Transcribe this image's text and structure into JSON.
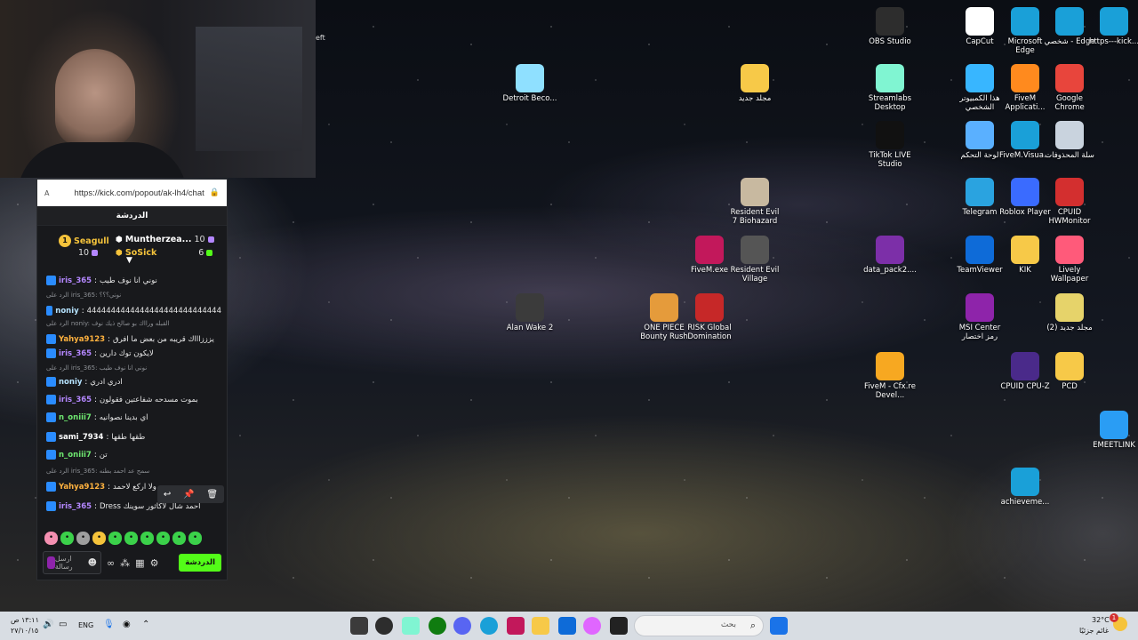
{
  "webcam": {
    "partial_text": "eft"
  },
  "chat": {
    "url": "https://kick.com/popout/ak-lh4/chat",
    "title": "الدردشة",
    "leaders": [
      {
        "rank": "1",
        "name": "Seagull",
        "count": "10",
        "color": "#f5c33b"
      },
      {
        "name": "Muntherzea...",
        "count": "10",
        "color": "#ffffff"
      },
      {
        "name": "SoSick",
        "count": "6",
        "color": "#f5c33b"
      }
    ],
    "messages": [
      {
        "reply": "",
        "user": "iris_365",
        "text": "نوني انا نوف طيب",
        "color": "#b487ff"
      },
      {
        "reply": "الرد على iris_365: نوني؟؟؟",
        "user": "",
        "text": "",
        "color": "#8c8f94"
      },
      {
        "reply": "",
        "user": "noniy",
        "text": "4444444444444444444444444444",
        "color": "#b6e3ff"
      },
      {
        "reply": "الرد على noniy: القبله ورااك بو صالح ذيك نوف",
        "user": "",
        "text": "",
        "color": "#8c8f94"
      },
      {
        "reply": "",
        "user": "Yahya9123",
        "text": "يزززاااك قريبه من بعض ما افرق",
        "color": "#ffb23f"
      },
      {
        "reply": "",
        "user": "iris_365",
        "text": "لايكون توك دارين",
        "color": "#b487ff"
      },
      {
        "reply": "الرد على iris_365: نوني انا نوف طيب",
        "user": "",
        "text": "",
        "color": "#8c8f94"
      },
      {
        "reply": "",
        "user": "noniy",
        "text": "ادري ادري",
        "color": "#b6e3ff"
      },
      {
        "reply": "",
        "user": "iris_365",
        "text": "بموت مسدحه شفاعتين فقولون",
        "color": "#b487ff"
      },
      {
        "reply": "",
        "user": "n_oniii7",
        "text": "اي بدينا نصوانيه",
        "color": "#6ee870"
      },
      {
        "reply": "",
        "user": "sami_7934",
        "text": "طقها طقها",
        "color": "#ffffff"
      },
      {
        "reply": "",
        "user": "n_oniii7",
        "text": "تن",
        "color": "#6ee870"
      },
      {
        "reply": "الرد على iris_365: سمح عد احمد بطنه",
        "user": "",
        "text": "",
        "color": "#8c8f94"
      },
      {
        "reply": "",
        "user": "Yahya9123",
        "text": "ولا اركع لاحمد",
        "color": "#ffb23f"
      },
      {
        "reply": "",
        "user": "iris_365",
        "text": "Dress احمد شال لاكاثور سوينك",
        "color": "#b487ff"
      }
    ],
    "input_placeholder": "ارسل رسالة",
    "send_label": "الدردشة"
  },
  "desktop_icons": [
    {
      "label": "OBS Studio",
      "color": "#2d2d2d"
    },
    {
      "label": "CapCut",
      "color": "#ffffff"
    },
    {
      "label": "Microsoft Edge",
      "color": "#1aa0d8"
    },
    {
      "label": "شخصي - Edge",
      "color": "#1aa0d8"
    },
    {
      "label": "https---kick...",
      "color": "#1aa0d8"
    },
    {
      "label": "Detroit Beco...",
      "color": "#8fe0ff"
    },
    {
      "label": "مجلد جديد",
      "color": "#f7c948"
    },
    {
      "label": "Streamlabs Desktop",
      "color": "#80f5d2"
    },
    {
      "label": "هذا الكمبيوتر الشخصي",
      "color": "#38b6ff"
    },
    {
      "label": "FiveM Applicati...",
      "color": "#ff8a1e"
    },
    {
      "label": "Google Chrome",
      "color": "#e8453c"
    },
    {
      "label": "TikTok LIVE Studio",
      "color": "#111111"
    },
    {
      "label": "لوحة التحكم",
      "color": "#5ab0ff"
    },
    {
      "label": "FiveM.Visua...",
      "color": "#1aa0d8"
    },
    {
      "label": "سلة المحذوفات",
      "color": "#c9d3de"
    },
    {
      "label": "Resident Evil 7 Biohazard",
      "color": "#c8b9a0"
    },
    {
      "label": "Telegram",
      "color": "#2aa3e0"
    },
    {
      "label": "Roblox Player",
      "color": "#3a6bff"
    },
    {
      "label": "CPUID HWMonitor",
      "color": "#d32f2f"
    },
    {
      "label": "FiveM.exe",
      "color": "#c2185b"
    },
    {
      "label": "Resident Evil Village",
      "color": "#555555"
    },
    {
      "label": "data_pack2....",
      "color": "#7c2fa8"
    },
    {
      "label": "TeamViewer",
      "color": "#0e6bd8"
    },
    {
      "label": "KIK",
      "color": "#f7c948"
    },
    {
      "label": "Lively Wallpaper",
      "color": "#ff5a7a"
    },
    {
      "label": "Alan Wake 2",
      "color": "#3b3b3b"
    },
    {
      "label": "ONE PIECE Bounty Rush",
      "color": "#e59b3b"
    },
    {
      "label": "RISK Global Domination",
      "color": "#c62828"
    },
    {
      "label": "MSI Center رمز اختصار",
      "color": "#8e24aa"
    },
    {
      "label": "مجلد جديد (2)",
      "color": "#e6d36a"
    },
    {
      "label": "FiveM - Cfx.re Devel...",
      "color": "#f7a821"
    },
    {
      "label": "CPUID CPU-Z",
      "color": "#4a2a8a"
    },
    {
      "label": "PCD",
      "color": "#f7c948"
    },
    {
      "label": "EMEETLINK",
      "color": "#2a9df4"
    },
    {
      "label": "achieveme...",
      "color": "#1aa0d8"
    }
  ],
  "taskbar": {
    "time": "١٣:١١",
    "period": "ص",
    "date": "٢٧/١٠/١٥",
    "language": "ENG",
    "search_placeholder": "بحث",
    "weather_temp": "32°C",
    "weather_desc": "غائم جزئيًا",
    "notification_count": "1"
  }
}
